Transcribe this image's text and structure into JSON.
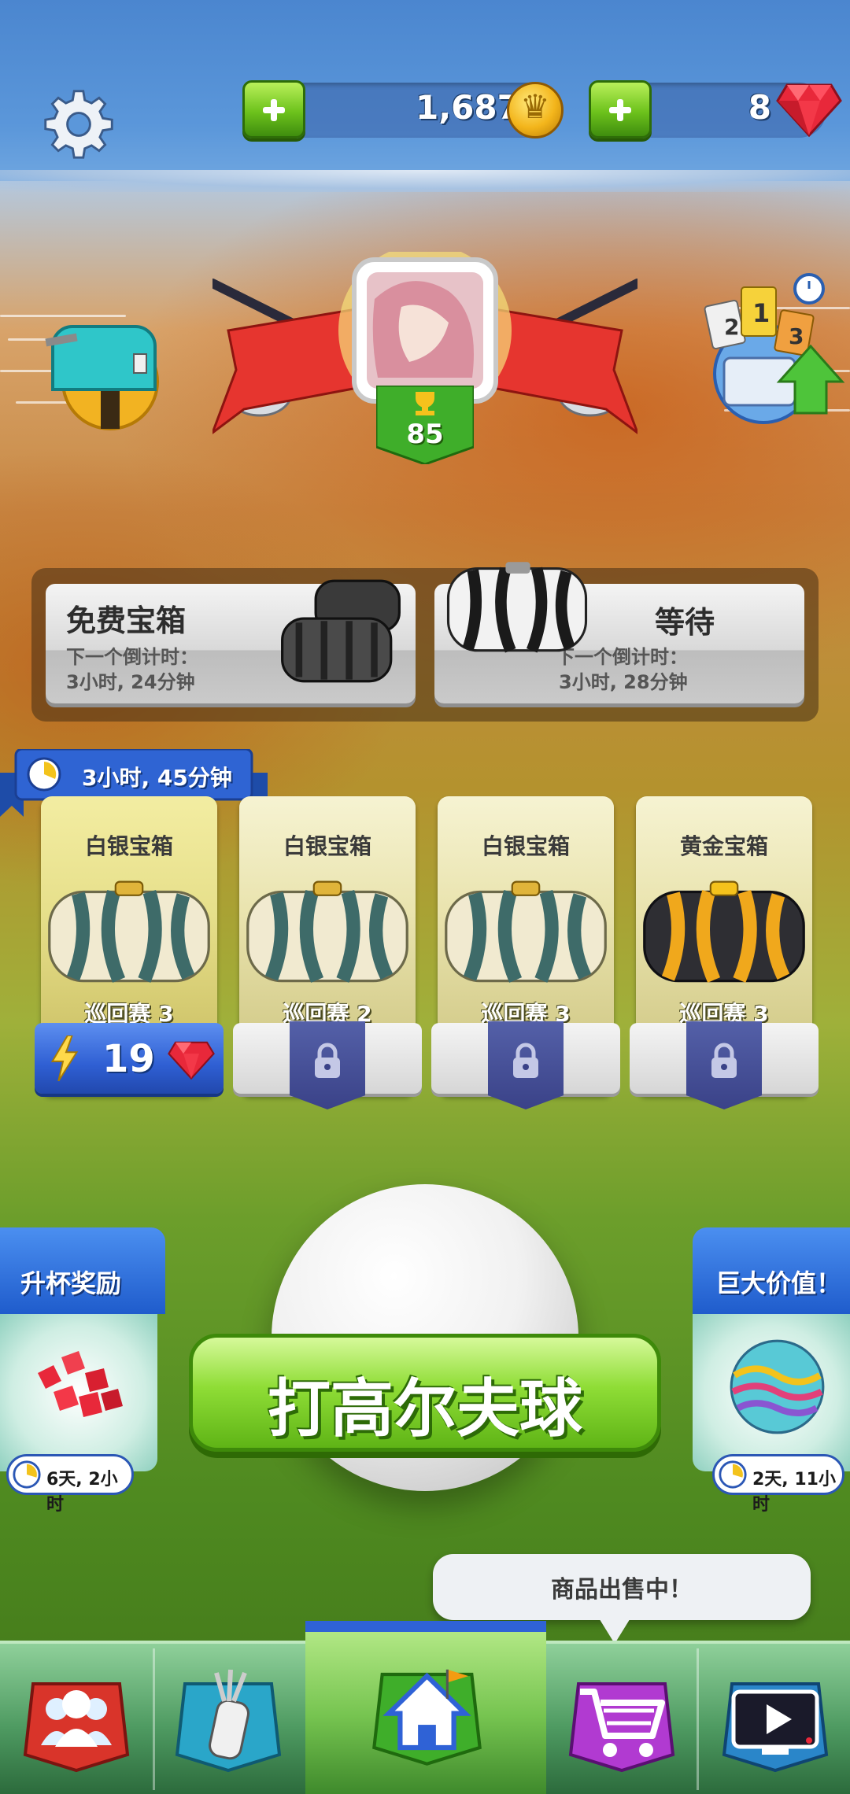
{
  "header": {
    "coins": "1,687",
    "gems": "8",
    "settings_icon": "gear-icon",
    "coin_icon": "crown-coin-icon",
    "gem_icon": "ruby-gem-icon"
  },
  "profile": {
    "level": "85",
    "left_badge": "mailbox-icon",
    "right_badge": "tour-leaderboard-icon"
  },
  "free_chests": {
    "free": {
      "title": "免费宝箱",
      "sub_line1": "下一个倒计时：",
      "sub_line2": "3小时, 24分钟"
    },
    "waiting": {
      "title": "等待",
      "sub_line1": "下一个倒计时：",
      "sub_line2": "3小时, 28分钟"
    }
  },
  "chest_slots": {
    "timer": "3小时, 45分钟",
    "items": [
      {
        "name": "白银宝箱",
        "tour": "巡回赛 3",
        "unlock_cost": "19",
        "locked": false,
        "color": "silver"
      },
      {
        "name": "白银宝箱",
        "tour": "巡回赛 2",
        "locked": true,
        "color": "silver"
      },
      {
        "name": "白银宝箱",
        "tour": "巡回赛 3",
        "locked": true,
        "color": "silver"
      },
      {
        "name": "黄金宝箱",
        "tour": "巡回赛 3",
        "locked": true,
        "color": "gold"
      }
    ]
  },
  "promos": {
    "left": {
      "title": "升杯奖励",
      "timer": "6天, 2小时"
    },
    "right": {
      "title": "巨大价值！",
      "timer": "2天, 11小时"
    }
  },
  "play": {
    "label": "打高尔夫球"
  },
  "sale_bubble": {
    "text": "商品出售中！"
  },
  "nav": {
    "items": [
      {
        "name": "clubs-social",
        "icon": "people-icon"
      },
      {
        "name": "golf-bag",
        "icon": "golf-bag-icon"
      },
      {
        "name": "home",
        "icon": "home-icon"
      },
      {
        "name": "shop",
        "icon": "cart-icon"
      },
      {
        "name": "tv",
        "icon": "tv-play-icon"
      }
    ]
  },
  "colors": {
    "sky": "#5b97da",
    "play_green": "#8fdd36",
    "gem_red": "#e8283a",
    "unlock_blue": "#2f5fd3",
    "lock_purple": "#3a4288"
  }
}
